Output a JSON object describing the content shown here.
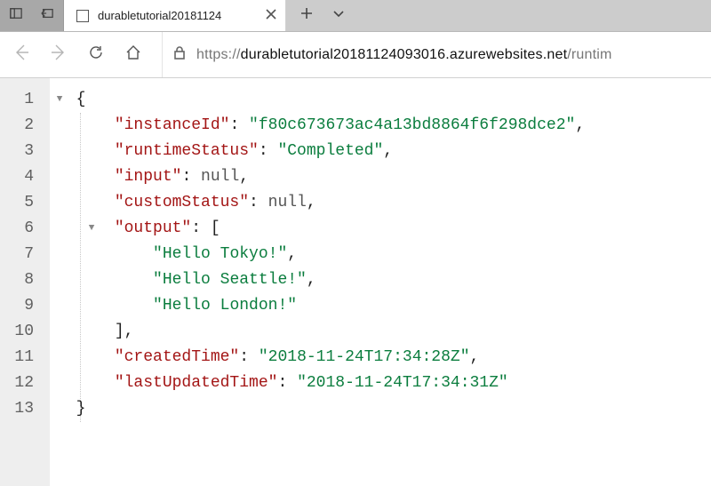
{
  "tab": {
    "title": "durabletutorial20181124"
  },
  "url": {
    "scheme": "https://",
    "host": "durabletutorial20181124093016.azurewebsites.net",
    "path": "/runtim"
  },
  "json_response": {
    "instanceId": "f80c673673ac4a13bd8864f6f298dce2",
    "runtimeStatus": "Completed",
    "input": null,
    "customStatus": null,
    "output": [
      "Hello Tokyo!",
      "Hello Seattle!",
      "Hello London!"
    ],
    "createdTime": "2018-11-24T17:34:28Z",
    "lastUpdatedTime": "2018-11-24T17:34:31Z"
  },
  "lines": {
    "l1": "{",
    "l2k": "\"instanceId\"",
    "l2v": "\"f80c673673ac4a13bd8864f6f298dce2\"",
    "l3k": "\"runtimeStatus\"",
    "l3v": "\"Completed\"",
    "l4k": "\"input\"",
    "l4v": "null",
    "l5k": "\"customStatus\"",
    "l5v": "null",
    "l6k": "\"output\"",
    "l7": "\"Hello Tokyo!\"",
    "l8": "\"Hello Seattle!\"",
    "l9": "\"Hello London!\"",
    "l11k": "\"createdTime\"",
    "l11v": "\"2018-11-24T17:34:28Z\"",
    "l12k": "\"lastUpdatedTime\"",
    "l12v": "\"2018-11-24T17:34:31Z\""
  },
  "line_numbers": [
    "1",
    "2",
    "3",
    "4",
    "5",
    "6",
    "7",
    "8",
    "9",
    "10",
    "11",
    "12",
    "13"
  ]
}
